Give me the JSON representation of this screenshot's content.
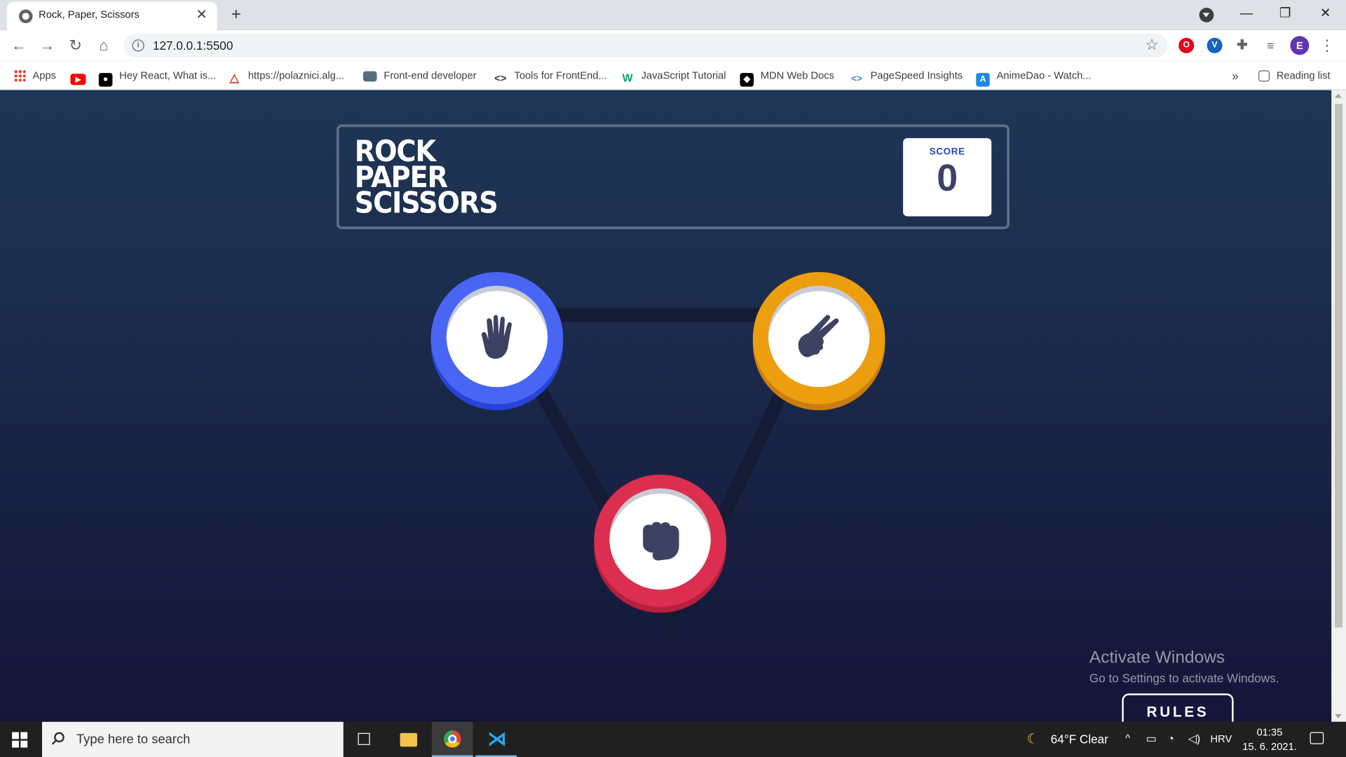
{
  "browser": {
    "tab_title": "Rock, Paper, Scissors",
    "tab_close": "✕",
    "new_tab": "+",
    "url": "127.0.0.1:5500",
    "window_controls": {
      "minimize": "—",
      "maximize": "❐",
      "close": "✕"
    },
    "profile_initial": "E"
  },
  "bookmarks": [
    {
      "label": "Apps",
      "icon": "apps-grid-icon"
    },
    {
      "label": "",
      "icon": "youtube-icon"
    },
    {
      "label": "Hey React, What is...",
      "icon": "medium-icon"
    },
    {
      "label": "https://polaznici.alg...",
      "icon": "algebra-icon"
    },
    {
      "label": "Front-end developer",
      "icon": "laptop-icon"
    },
    {
      "label": "Tools for FrontEnd...",
      "icon": "code-icon"
    },
    {
      "label": "JavaScript Tutorial",
      "icon": "w3schools-icon"
    },
    {
      "label": "MDN Web Docs",
      "icon": "mdn-icon"
    },
    {
      "label": "PageSpeed Insights",
      "icon": "pagespeed-icon"
    },
    {
      "label": "AnimeDao - Watch...",
      "icon": "animedao-icon"
    }
  ],
  "bookmarks_overflow": "»",
  "reading_list": "Reading list",
  "game": {
    "title_lines": [
      "ROCK",
      "PAPER",
      "SCISSORS"
    ],
    "score_label": "SCORE",
    "score_value": "0",
    "tokens": [
      {
        "name": "paper",
        "icon": "paper-hand-icon",
        "color": "#4865f4"
      },
      {
        "name": "scissors",
        "icon": "scissors-hand-icon",
        "color": "#ec9e0e"
      },
      {
        "name": "rock",
        "icon": "rock-hand-icon",
        "color": "#dc2e4e"
      }
    ],
    "rules_label": "RULES"
  },
  "watermark": {
    "title": "Activate Windows",
    "subtitle": "Go to Settings to activate Windows."
  },
  "taskbar": {
    "search_placeholder": "Type here to search",
    "weather": "64°F  Clear",
    "language": "HRV",
    "time": "01:35",
    "date": "15. 6. 2021."
  }
}
